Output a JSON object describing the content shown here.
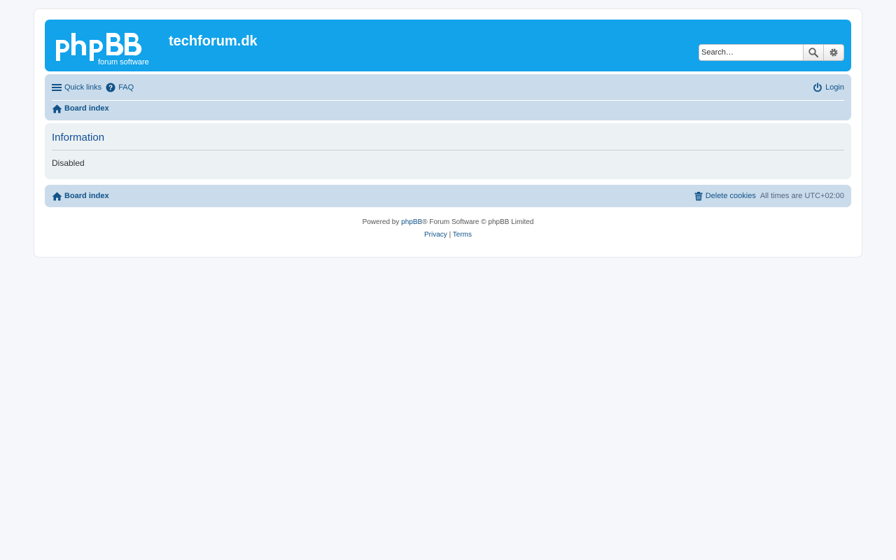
{
  "site": {
    "title": "techforum.dk",
    "logo_text_main": "phpBB",
    "logo_text_sub": "forum software"
  },
  "search": {
    "placeholder": "Search…",
    "button_label": "Search",
    "advanced_label": "Advanced search"
  },
  "nav": {
    "quick_links": "Quick links",
    "faq": "FAQ",
    "login": "Login",
    "breadcrumb": "Board index"
  },
  "panel": {
    "heading": "Information",
    "message": "Disabled"
  },
  "footer_nav": {
    "breadcrumb": "Board index",
    "delete_cookies": "Delete cookies",
    "times_label": "All times are",
    "timezone": "UTC+02:00"
  },
  "copyright": {
    "powered_by": "Powered by",
    "phpbb_link": "phpBB",
    "suffix": "® Forum Software © phpBB Limited",
    "privacy": "Privacy",
    "separator": "|",
    "terms": "Terms"
  },
  "colors": {
    "header_bg": "#12a3eb",
    "navbar_bg": "#cadceb",
    "panel_bg": "#ecf1f3",
    "link": "#105289",
    "page_bg": "#f5f7fa"
  }
}
